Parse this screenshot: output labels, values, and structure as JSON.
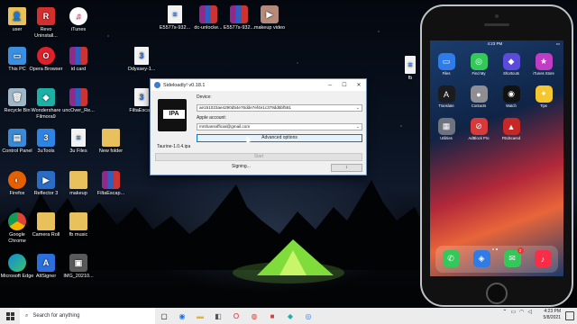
{
  "desktop": {
    "icons": [
      {
        "label": "user",
        "icon": "user-folder-icon"
      },
      {
        "label": "Revo Uninstall...",
        "icon": "revo-uninstaller-icon"
      },
      {
        "label": "iTunes",
        "icon": "itunes-icon"
      },
      {
        "label": "This PC",
        "icon": "this-pc-icon"
      },
      {
        "label": "Opera Browser",
        "icon": "opera-icon"
      },
      {
        "label": "id card",
        "icon": "rar-archive-icon"
      },
      {
        "label": "Recycle Bin",
        "icon": "recycle-bin-icon"
      },
      {
        "label": "Wondershare Filmora9",
        "icon": "filmora-icon"
      },
      {
        "label": "uncOver_Re...",
        "icon": "rar-archive-icon"
      },
      {
        "label": "Control Panel",
        "icon": "control-panel-icon"
      },
      {
        "label": "3uTools",
        "icon": "3utools-icon"
      },
      {
        "label": "3u Files",
        "icon": "document-icon"
      },
      {
        "label": "New folder",
        "icon": "folder-icon"
      },
      {
        "label": "Firefox",
        "icon": "firefox-icon"
      },
      {
        "label": "Reflector 3",
        "icon": "reflector-icon"
      },
      {
        "label": "makeup",
        "icon": "folder-icon"
      },
      {
        "label": "FiltaEscap...",
        "icon": "rar-archive-icon"
      },
      {
        "label": "Google Chrome",
        "icon": "chrome-icon"
      },
      {
        "label": "Camera Roll",
        "icon": "camera-roll-folder-icon"
      },
      {
        "label": "fb music",
        "icon": "folder-icon"
      },
      {
        "label": "Microsoft Edge",
        "icon": "edge-icon"
      },
      {
        "label": "AltSigner",
        "icon": "altsigner-icon"
      },
      {
        "label": "IMG_20210...",
        "icon": "image-file-icon"
      },
      {
        "label": "E5577s-932...",
        "icon": "document-icon"
      },
      {
        "label": "dc-unlocke...",
        "icon": "rar-archive-icon"
      },
      {
        "label": "E5577s-932...",
        "icon": "rar-archive-icon"
      },
      {
        "label": "makeup video",
        "icon": "video-file-icon"
      },
      {
        "label": "Odyssey-1...",
        "icon": "document-icon"
      },
      {
        "label": "FiltaEsca...",
        "icon": "document-icon"
      },
      {
        "label": "fb",
        "icon": "document-icon"
      }
    ]
  },
  "sideloadly": {
    "title": "Sideloadly! v0.18.1",
    "ipa_icon_text": "IPA",
    "device_label": "Device:",
    "device_value": "ae151023ae4290d54e76dde7ef4e1c379dd5bf581",
    "account_label": "Apple account:",
    "account_value": "mrshansofficial@gmail.com",
    "advanced_label": "Advanced options",
    "ipa_filename": "Taurine-1.0.4.ipa",
    "start_label": "Start",
    "status_text": "Signing...",
    "arrows_label": "↕"
  },
  "phone": {
    "status_left": "",
    "status_time": "4:23 PM",
    "apps": [
      {
        "label": "Files",
        "color": "#2f7be8",
        "glyph": "▭"
      },
      {
        "label": "Find My",
        "color": "#34c759",
        "glyph": "◎"
      },
      {
        "label": "Shortcuts",
        "color": "#5b4bdb",
        "glyph": "◆"
      },
      {
        "label": "iTunes Store",
        "color": "#c13cc4",
        "glyph": "★"
      },
      {
        "label": "Translate",
        "color": "#1c1c1e",
        "glyph": "A"
      },
      {
        "label": "Contacts",
        "color": "#8e8e93",
        "glyph": "●"
      },
      {
        "label": "Watch",
        "color": "#111111",
        "glyph": "◉"
      },
      {
        "label": "Tips",
        "color": "#f6c62f",
        "glyph": "✦"
      },
      {
        "label": "Utilities",
        "color": "#6f7380",
        "glyph": "▦"
      },
      {
        "label": "AdBlock Pro",
        "color": "#d63a3a",
        "glyph": "⊘"
      },
      {
        "label": "FEdscared",
        "color": "#c62828",
        "glyph": "▲"
      }
    ],
    "dock": [
      {
        "label": "Phone",
        "color": "#34c759",
        "glyph": "✆",
        "badge": ""
      },
      {
        "label": "Safari",
        "color": "#2f7be8",
        "glyph": "◈",
        "badge": ""
      },
      {
        "label": "Messages",
        "color": "#34c759",
        "glyph": "✉",
        "badge": "2"
      },
      {
        "label": "Music",
        "color": "#fa2d48",
        "glyph": "♪",
        "badge": ""
      }
    ]
  },
  "taskbar": {
    "search_placeholder": "Search for anything",
    "time": "4:23 PM",
    "date": "5/8/2021"
  }
}
